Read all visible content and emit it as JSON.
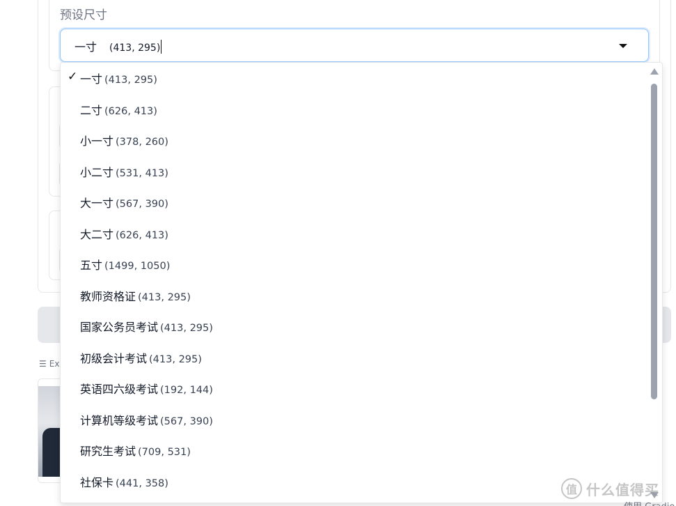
{
  "preset_size": {
    "label": "预设尺寸",
    "selected_name": "一寸",
    "selected_dims": "(413, 295)"
  },
  "options": [
    {
      "name": "一寸",
      "dims": "(413, 295)",
      "checked": true
    },
    {
      "name": "二寸",
      "dims": "(626, 413)"
    },
    {
      "name": "小一寸",
      "dims": "(378, 260)"
    },
    {
      "name": "小二寸",
      "dims": "(531, 413)"
    },
    {
      "name": "大一寸",
      "dims": "(567, 390)"
    },
    {
      "name": "大二寸",
      "dims": "(626, 413)"
    },
    {
      "name": "五寸",
      "dims": "(1499, 1050)"
    },
    {
      "name": "教师资格证",
      "dims": "(413, 295)"
    },
    {
      "name": "国家公务员考试",
      "dims": "(413, 295)"
    },
    {
      "name": "初级会计考试",
      "dims": "(413, 295)"
    },
    {
      "name": "英语四六级考试",
      "dims": "(192, 144)"
    },
    {
      "name": "计算机等级考试",
      "dims": "(567, 390)"
    },
    {
      "name": "研究生考试",
      "dims": "(709, 531)"
    },
    {
      "name": "社保卡",
      "dims": "(441, 358)"
    }
  ],
  "check_mark": "✓",
  "examples_label": "Ex",
  "examples_icon": "list-icon",
  "watermark": {
    "logo_text": "值",
    "text": "什么值得买"
  },
  "bottom_text": "使用 Gradio",
  "colors": {
    "focus_border": "#93c5fd",
    "scroll_thumb": "#9ca3af"
  }
}
